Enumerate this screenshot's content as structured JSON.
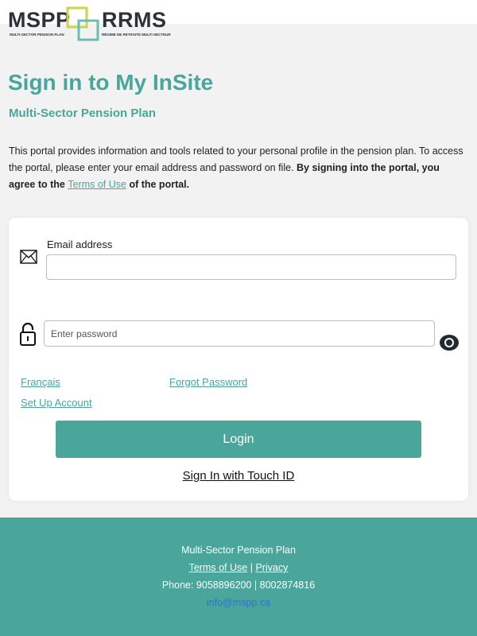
{
  "logo": {
    "left_name": "MSPP",
    "left_sub": "MULTI-SECTOR PENSION PLAN",
    "right_name": "RRMS",
    "right_sub": "RÉGIME DE RETRAITE MULTI-SECTEUR"
  },
  "header": {
    "title": "Sign in to My InSite",
    "subtitle": "Multi-Sector Pension Plan"
  },
  "intro": {
    "text": "This portal provides information and tools related to your personal profile in the pension plan. To access the portal, please enter your email address and password on file. ",
    "bold_text": "By signing into the portal, you agree to the ",
    "terms_link": "Terms of Use",
    "bold_tail": " of the portal."
  },
  "form": {
    "email_label": "Email address",
    "email_value": "",
    "password_placeholder": "Enter password",
    "password_value": "",
    "icons": {
      "email": "envelope-icon",
      "password": "lock-icon",
      "reveal": "eye-icon"
    }
  },
  "links": {
    "french": "Français",
    "forgot": "Forgot Password",
    "setup": "Set Up Account"
  },
  "buttons": {
    "login": "Login",
    "touch_id": "Sign In with Touch ID"
  },
  "footer": {
    "plan": "Multi-Sector Pension Plan",
    "terms": "Terms of Use",
    "separator": "|",
    "privacy": "Privacy",
    "phone": "Phone: 9058896200 | 8002874816",
    "email": "info@mspp.ca"
  },
  "colors": {
    "accent": "#4aa59a",
    "background": "#f2f2f2",
    "email_link": "#2f6fe0"
  }
}
